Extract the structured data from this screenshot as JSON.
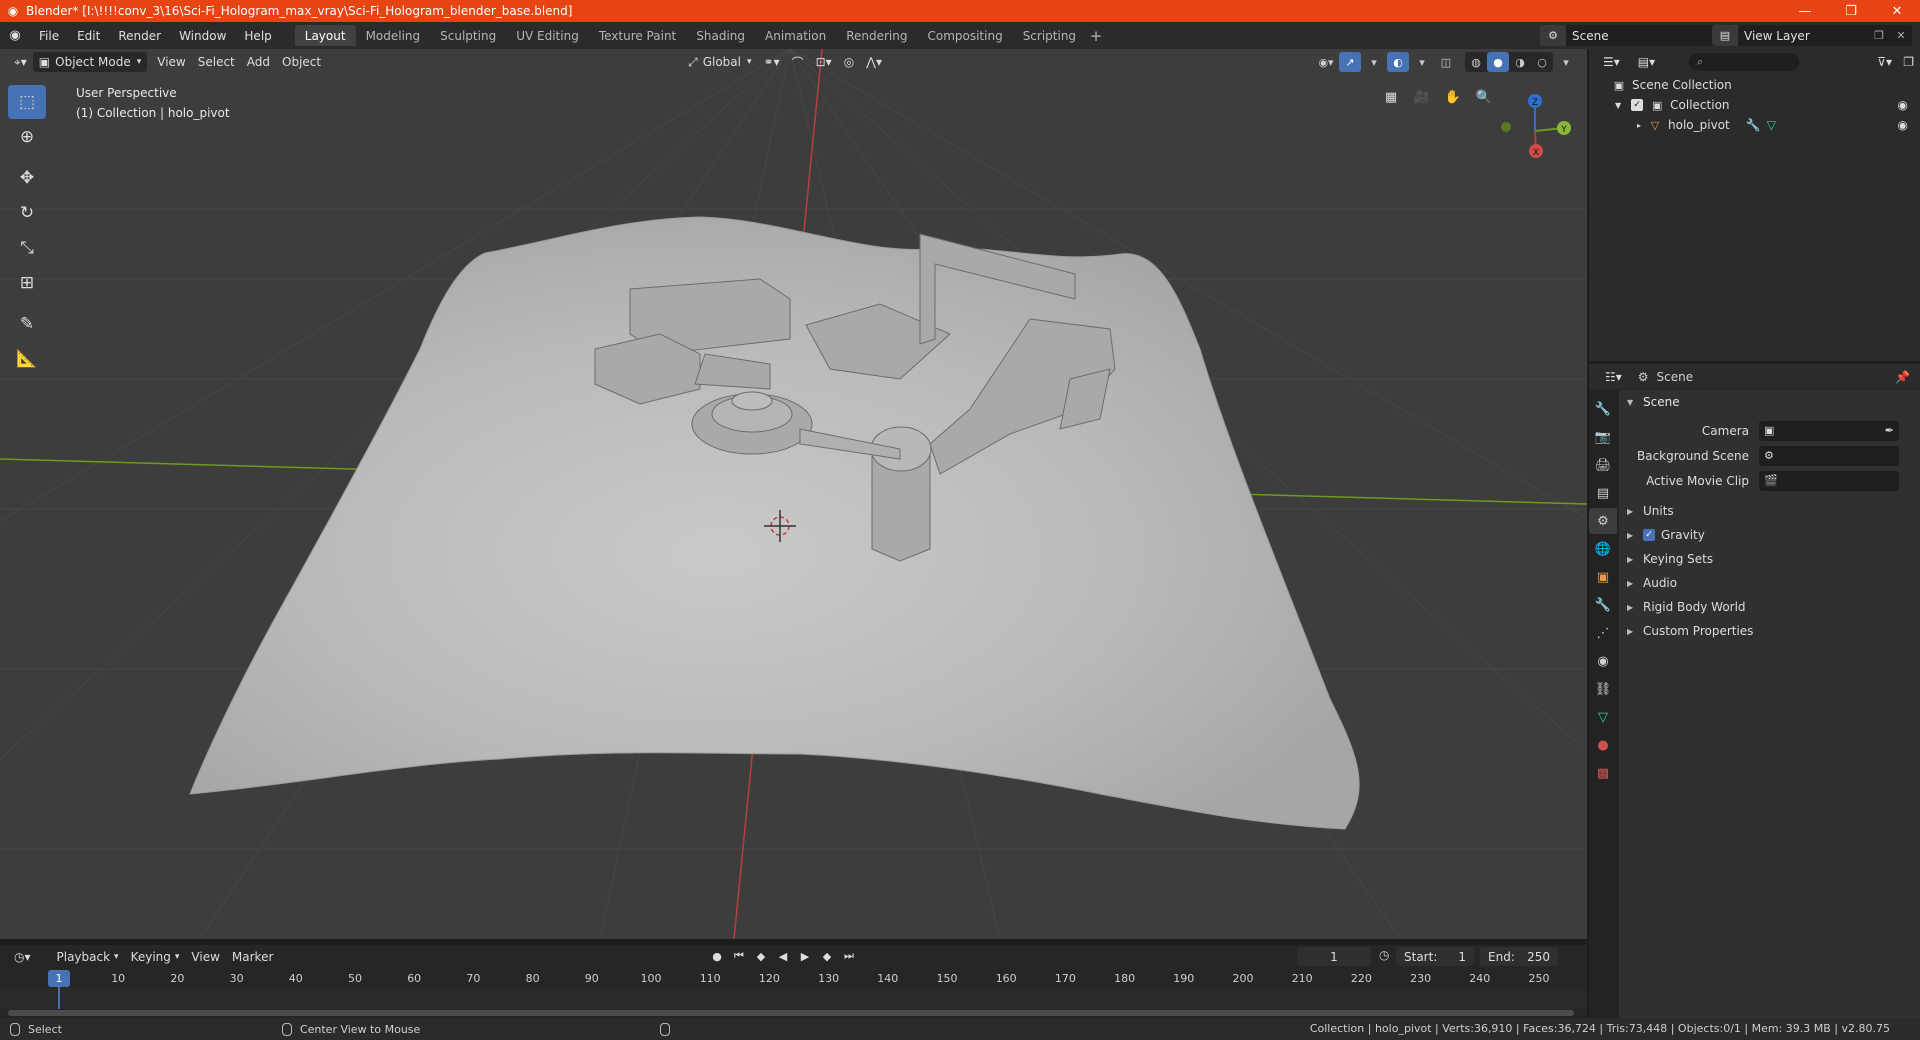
{
  "window": {
    "title": "Blender* [I:\\!!!!conv_3\\16\\Sci-Fi_Hologram_max_vray\\Sci-Fi_Hologram_blender_base.blend]",
    "minimize": "—",
    "restore": "❐",
    "close": "✕"
  },
  "menu": [
    "File",
    "Edit",
    "Render",
    "Window",
    "Help"
  ],
  "workspaces": [
    "Layout",
    "Modeling",
    "Sculpting",
    "UV Editing",
    "Texture Paint",
    "Shading",
    "Animation",
    "Rendering",
    "Compositing",
    "Scripting"
  ],
  "active_workspace": "Layout",
  "scene_selector": {
    "value": "Scene"
  },
  "viewlayer_selector": {
    "value": "View Layer"
  },
  "viewport": {
    "mode": "Object Mode",
    "menus": [
      "View",
      "Select",
      "Add",
      "Object"
    ],
    "orientation": "Global",
    "perspective": "User Perspective",
    "context": "(1) Collection | holo_pivot",
    "axes": {
      "x": "X",
      "y": "Y",
      "z": "Z"
    },
    "colors": {
      "background": "#3d3d3d",
      "mesh": "#bfbfbf",
      "x_axis": "#b5403f",
      "y_axis": "#6e9a1f"
    }
  },
  "tools": [
    "select-box",
    "cursor",
    "move",
    "rotate",
    "scale",
    "transform",
    "annotate",
    "measure"
  ],
  "timeline": {
    "menus": [
      "Playback",
      "Keying",
      "View",
      "Marker"
    ],
    "current_frame": "1",
    "start_label": "Start:",
    "start": "1",
    "end_label": "End:",
    "end": "250",
    "ticks": [
      "10",
      "20",
      "30",
      "40",
      "50",
      "60",
      "70",
      "80",
      "90",
      "100",
      "110",
      "120",
      "130",
      "140",
      "150",
      "160",
      "170",
      "180",
      "190",
      "200",
      "210",
      "220",
      "230",
      "240",
      "250"
    ],
    "cursor_label": "1"
  },
  "status": {
    "select": "Select",
    "center": "Center View to Mouse",
    "stats": "Collection | holo_pivot | Verts:36,910 | Faces:36,724 | Tris:73,448 | Objects:0/1 | Mem: 39.3 MB | v2.80.75"
  },
  "outliner": {
    "root": "Scene Collection",
    "collection": "Collection",
    "object": "holo_pivot"
  },
  "properties": {
    "header": "Scene",
    "panel": "Scene",
    "camera_label": "Camera",
    "background_scene_label": "Background Scene",
    "active_movie_clip_label": "Active Movie Clip",
    "subpanels": [
      "Units",
      "Gravity",
      "Keying Sets",
      "Audio",
      "Rigid Body World",
      "Custom Properties"
    ]
  }
}
